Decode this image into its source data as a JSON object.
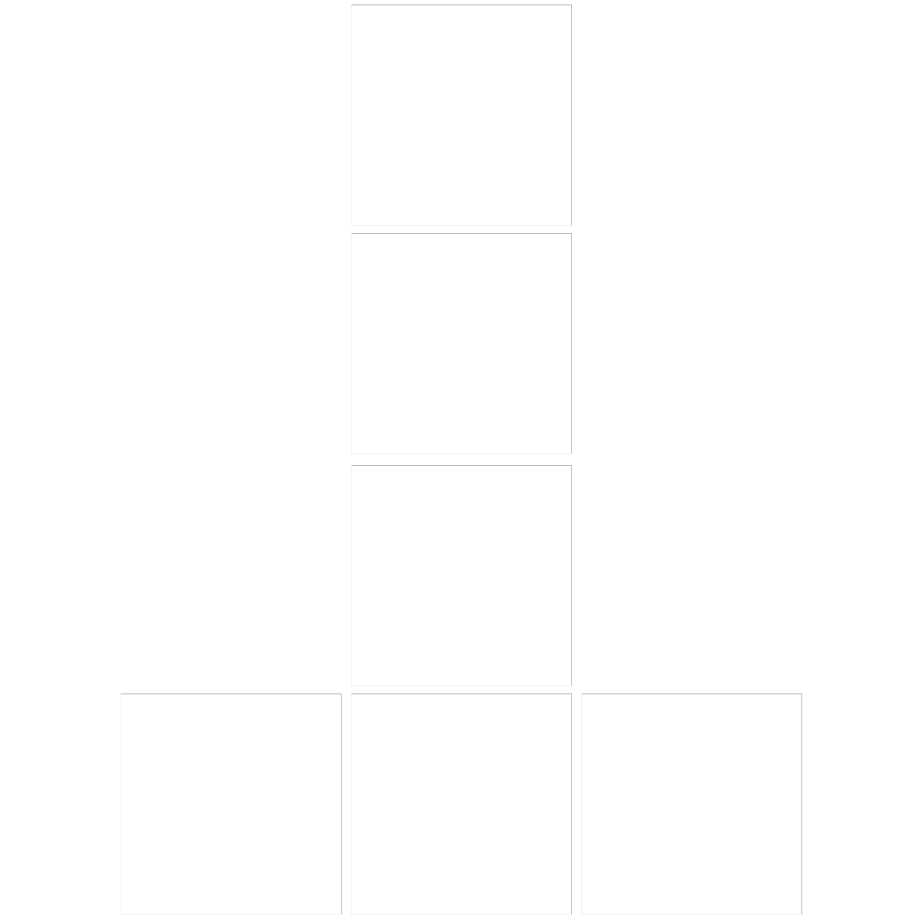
{
  "board": {
    "tile_count": 6,
    "tile_labels": [
      "",
      "",
      "",
      "",
      "",
      ""
    ]
  },
  "colors": {
    "background": "#ffffff",
    "tile_fill": "#ffffff",
    "tile_border_dark": "#bdbdbd",
    "tile_border_light": "#f3f3f3"
  }
}
